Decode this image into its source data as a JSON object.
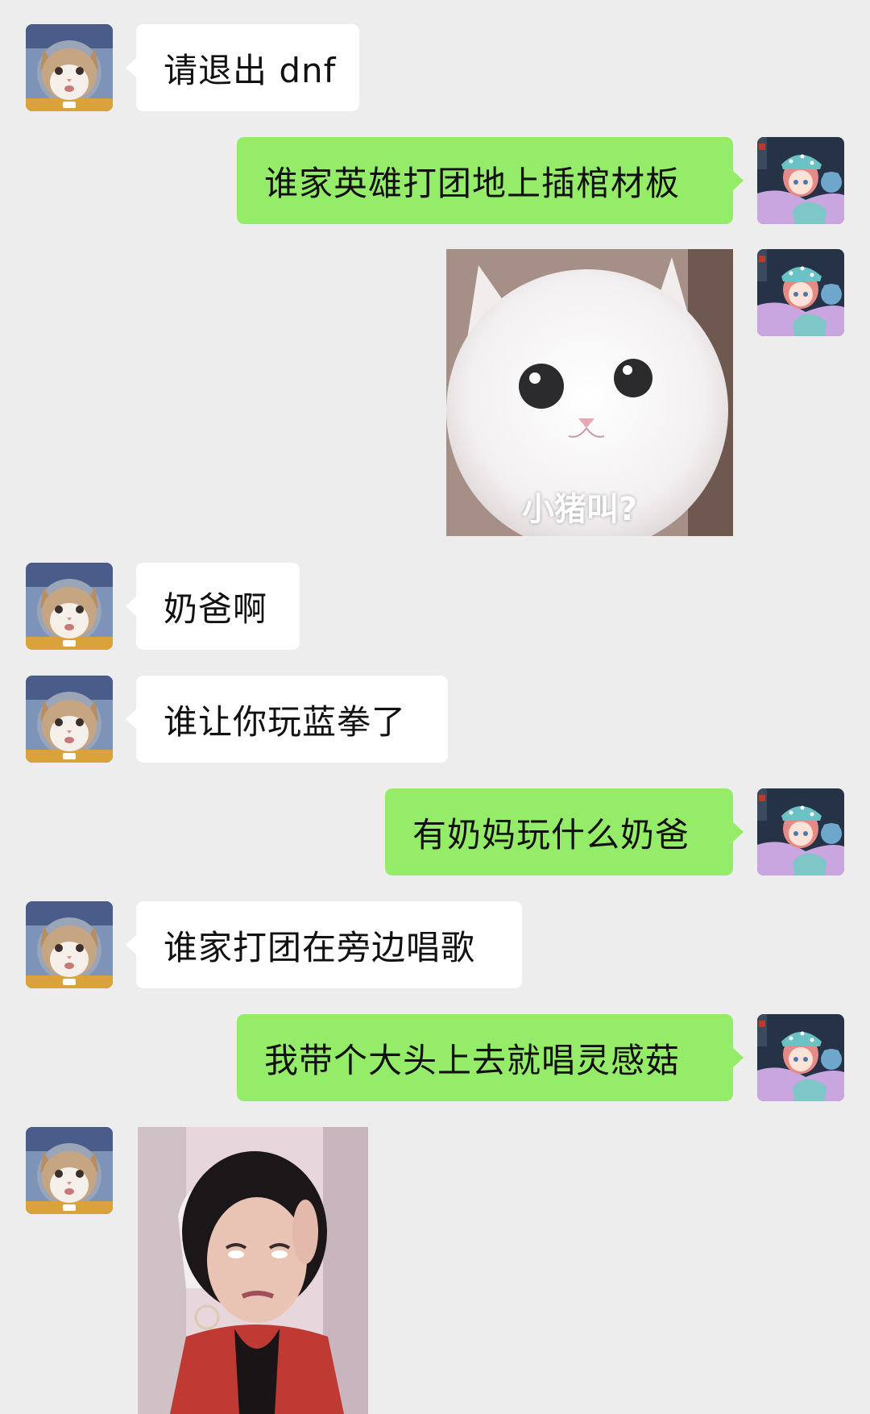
{
  "colors": {
    "background": "#ededed",
    "incoming_bubble": "#ffffff",
    "outgoing_bubble": "#95ec69"
  },
  "contacts": {
    "other": {
      "avatar_icon": "cat-avatar-icon"
    },
    "self": {
      "avatar_icon": "anime-girl-avatar-icon"
    }
  },
  "messages": [
    {
      "sender": "other",
      "type": "text",
      "text": "请退出 dnf"
    },
    {
      "sender": "self",
      "type": "text",
      "text": "谁家英雄打团地上插棺材板"
    },
    {
      "sender": "self",
      "type": "image",
      "image_icon": "white-cat-meme-image",
      "caption": "小猪叫?"
    },
    {
      "sender": "other",
      "type": "text",
      "text": "奶爸啊"
    },
    {
      "sender": "other",
      "type": "text",
      "text": "谁让你玩蓝拳了"
    },
    {
      "sender": "self",
      "type": "text",
      "text": "有奶妈玩什么奶爸"
    },
    {
      "sender": "other",
      "type": "text",
      "text": "谁家打团在旁边唱歌"
    },
    {
      "sender": "self",
      "type": "text",
      "text": "我带个大头上去就唱灵感菇"
    },
    {
      "sender": "other",
      "type": "image",
      "image_icon": "girl-eye-roll-meme-image",
      "caption": ""
    }
  ]
}
